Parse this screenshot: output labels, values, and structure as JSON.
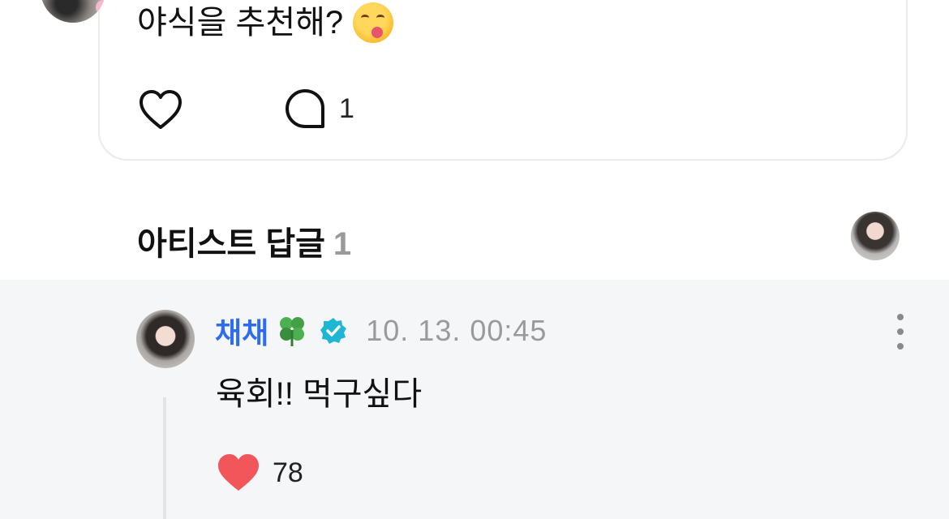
{
  "post": {
    "text": "야식을 추천해?",
    "emoji": "face-savoring-food",
    "comment_count": "1"
  },
  "artist_replies": {
    "title": "아티스트 답글",
    "count": "1"
  },
  "reply": {
    "author": "채채",
    "author_emoji": "four-leaf-clover",
    "timestamp": "10. 13. 00:45",
    "text": "육회!! 먹구싶다",
    "like_count": "78"
  },
  "colors": {
    "accent_name": "#2d6cf0",
    "verified": "#1fb6d4",
    "heart": "#f2555a",
    "reply_bg": "#f5f6f8"
  }
}
